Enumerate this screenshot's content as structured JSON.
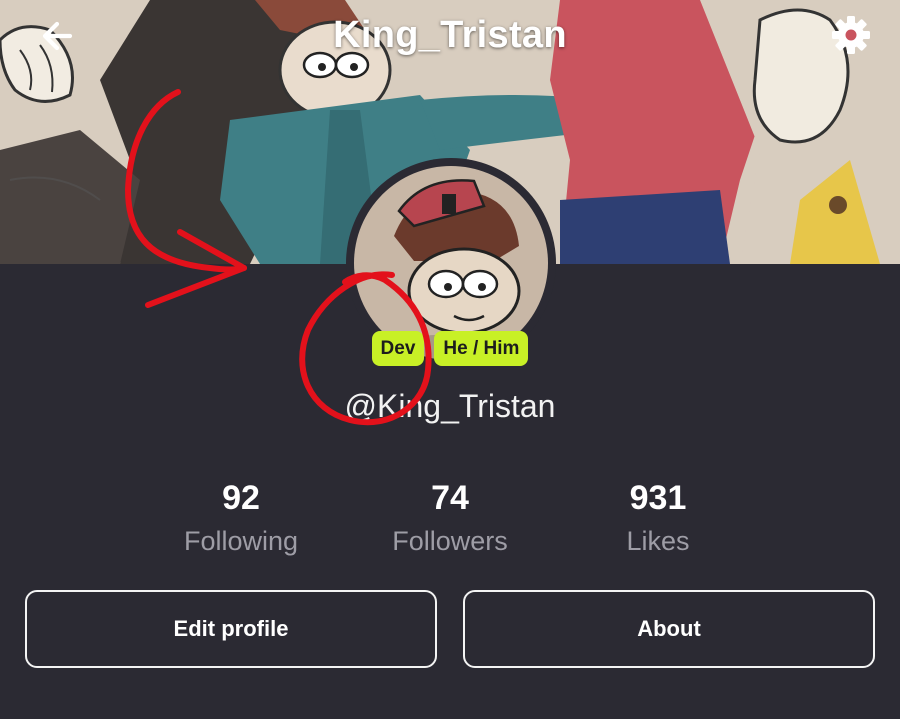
{
  "header": {
    "title": "King_Tristan",
    "back_icon": "arrow-left-icon",
    "settings_icon": "gear-icon"
  },
  "profile": {
    "badges": [
      "Dev",
      "He / Him"
    ],
    "handle": "@King_Tristan"
  },
  "stats": [
    {
      "value": "92",
      "label": "Following"
    },
    {
      "value": "74",
      "label": "Followers"
    },
    {
      "value": "931",
      "label": "Likes"
    }
  ],
  "actions": {
    "edit_label": "Edit profile",
    "about_label": "About"
  },
  "colors": {
    "background": "#2b2a33",
    "badge": "#c8f026",
    "annotation": "#e3111b",
    "muted_text": "#9e9da6"
  }
}
